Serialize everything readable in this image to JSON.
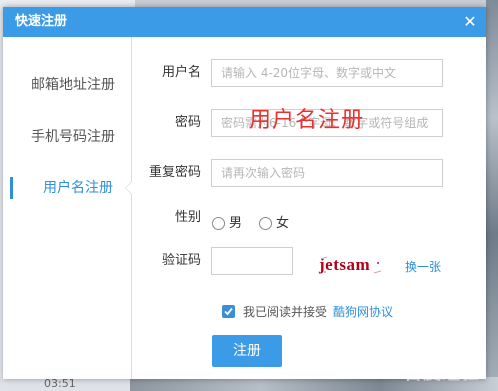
{
  "background": {
    "time_text": "03:51",
    "watermark": "Bai百度经验"
  },
  "dialog": {
    "title": "快速注册",
    "close_glyph": "✕"
  },
  "nav": {
    "items": [
      {
        "label": "邮箱地址注册",
        "active": false
      },
      {
        "label": "手机号码注册",
        "active": false
      },
      {
        "label": "用户名注册",
        "active": true
      }
    ]
  },
  "form": {
    "username": {
      "label": "用户名",
      "placeholder": "请输入 4-20位字母、数字或中文"
    },
    "password": {
      "label": "密码",
      "placeholder": "密码需为6-16个字母、数字或符号组成"
    },
    "confirm_password": {
      "label": "重复密码",
      "placeholder": "请再次输入密码"
    },
    "gender": {
      "label": "性别",
      "options": [
        "男",
        "女"
      ],
      "selected": null
    },
    "captcha": {
      "label": "验证码",
      "value": "",
      "image_text": "jetsam",
      "refresh_label": "换一张"
    },
    "agreement": {
      "checked": true,
      "text": "我已阅读并接受",
      "link_text": "酷狗网协议"
    },
    "submit_label": "注册"
  },
  "overlay_caption": "用户名注册",
  "colors": {
    "accent": "#3c9be6",
    "link": "#2f8fd8",
    "overlay": "#e8322f",
    "captcha": "#b3001a"
  }
}
